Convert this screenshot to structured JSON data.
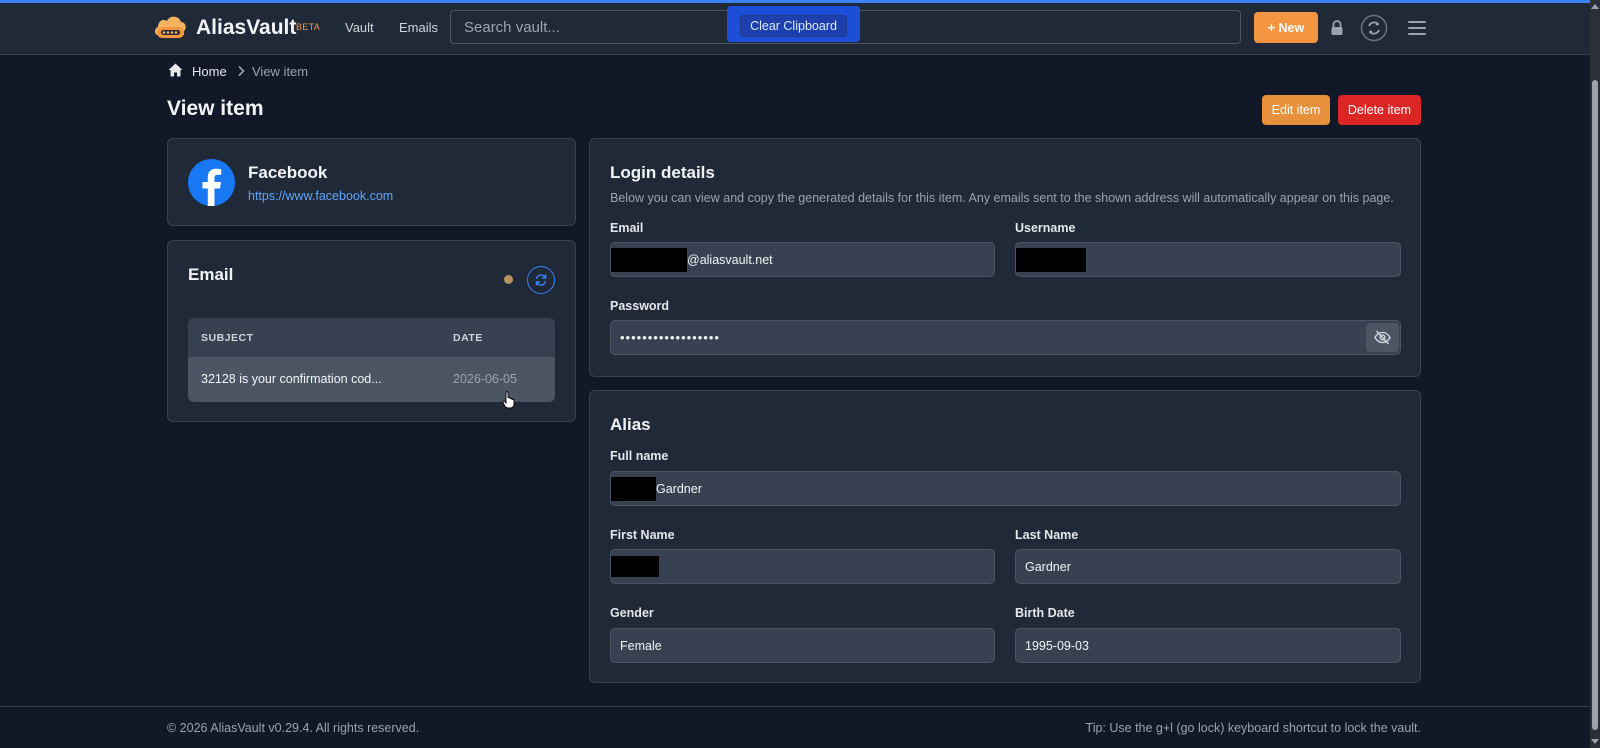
{
  "header": {
    "brand": "AliasVault",
    "beta": "BETA",
    "nav": [
      "Vault",
      "Emails"
    ],
    "search_placeholder": "Search vault...",
    "clear_clipboard": "Clear Clipboard",
    "new_label": "+ New"
  },
  "breadcrumb": {
    "home": "Home",
    "current": "View item"
  },
  "page": {
    "title": "View item",
    "edit_label": "Edit item",
    "delete_label": "Delete item"
  },
  "service": {
    "name": "Facebook",
    "url": "https://www.facebook.com"
  },
  "email_panel": {
    "title": "Email",
    "columns": [
      "SUBJECT",
      "DATE"
    ],
    "rows": [
      {
        "subject": "32128 is your confirmation cod...",
        "date": "2026-06-05"
      }
    ]
  },
  "login": {
    "title": "Login details",
    "description": "Below you can view and copy the generated details for this item. Any emails sent to the shown address will automatically appear on this page.",
    "email_label": "Email",
    "email_domain": "@aliasvault.net",
    "username_label": "Username",
    "password_label": "Password",
    "password_mask": "••••••••••••••••••"
  },
  "alias": {
    "title": "Alias",
    "full_name_label": "Full name",
    "full_name_suffix": "Gardner",
    "first_name_label": "First Name",
    "last_name_label": "Last Name",
    "last_name": "Gardner",
    "gender_label": "Gender",
    "gender": "Female",
    "birth_date_label": "Birth Date",
    "birth_date": "1995-09-03"
  },
  "footer": {
    "copyright": "© 2026 AliasVault v0.29.4. All rights reserved.",
    "tip": "Tip: Use the g+l (go lock) keyboard shortcut to lock the vault."
  },
  "colors": {
    "accent": "#f49541",
    "primary": "#3b82f6",
    "danger": "#dc2626",
    "background": "#111827",
    "panel": "#1f2937"
  }
}
